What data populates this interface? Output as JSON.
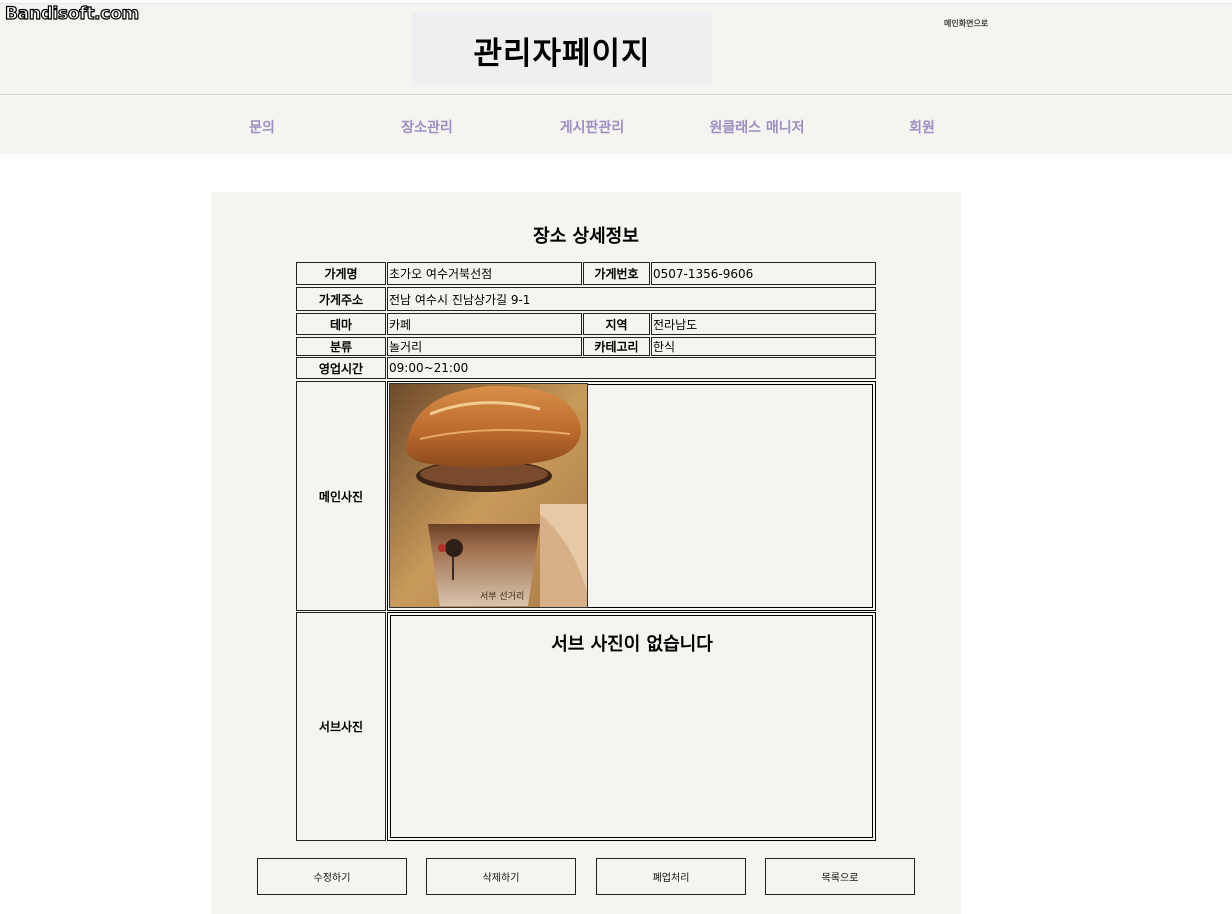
{
  "watermark": "Bandisoft.com",
  "header": {
    "title": "관리자페이지",
    "home_link": "메인화면으로"
  },
  "nav": {
    "items": [
      {
        "label": "문의"
      },
      {
        "label": "장소관리"
      },
      {
        "label": "게시판관리"
      },
      {
        "label": "원클래스 매니저"
      },
      {
        "label": "회원"
      }
    ],
    "link_color": "#9b8fc2"
  },
  "detail": {
    "title": "장소 상세정보",
    "fields": {
      "store_name_label": "가게명",
      "store_name": "초가오 여수거북선점",
      "phone_label": "가게번호",
      "phone": "0507-1356-9606",
      "address_label": "가게주소",
      "address": "전남 여수시 진남상가길 9-1",
      "theme_label": "테마",
      "theme": "카페",
      "region_label": "지역",
      "region": "전라남도",
      "class_label": "분류",
      "class_value": "놀거리",
      "category_label": "카테고리",
      "category": "한식",
      "hours_label": "영업시간",
      "hours": "09:00~21:00",
      "main_photo_label": "메인사진",
      "sub_photo_label": "서브사진"
    },
    "no_sub_photo": "서브 사진이 없습니다"
  },
  "buttons": {
    "edit": "수정하기",
    "delete": "삭제하기",
    "close_business": "폐업처리",
    "to_list": "목록으로"
  },
  "colors": {
    "background": "#f5f4f0",
    "title_box": "#efeff1"
  }
}
